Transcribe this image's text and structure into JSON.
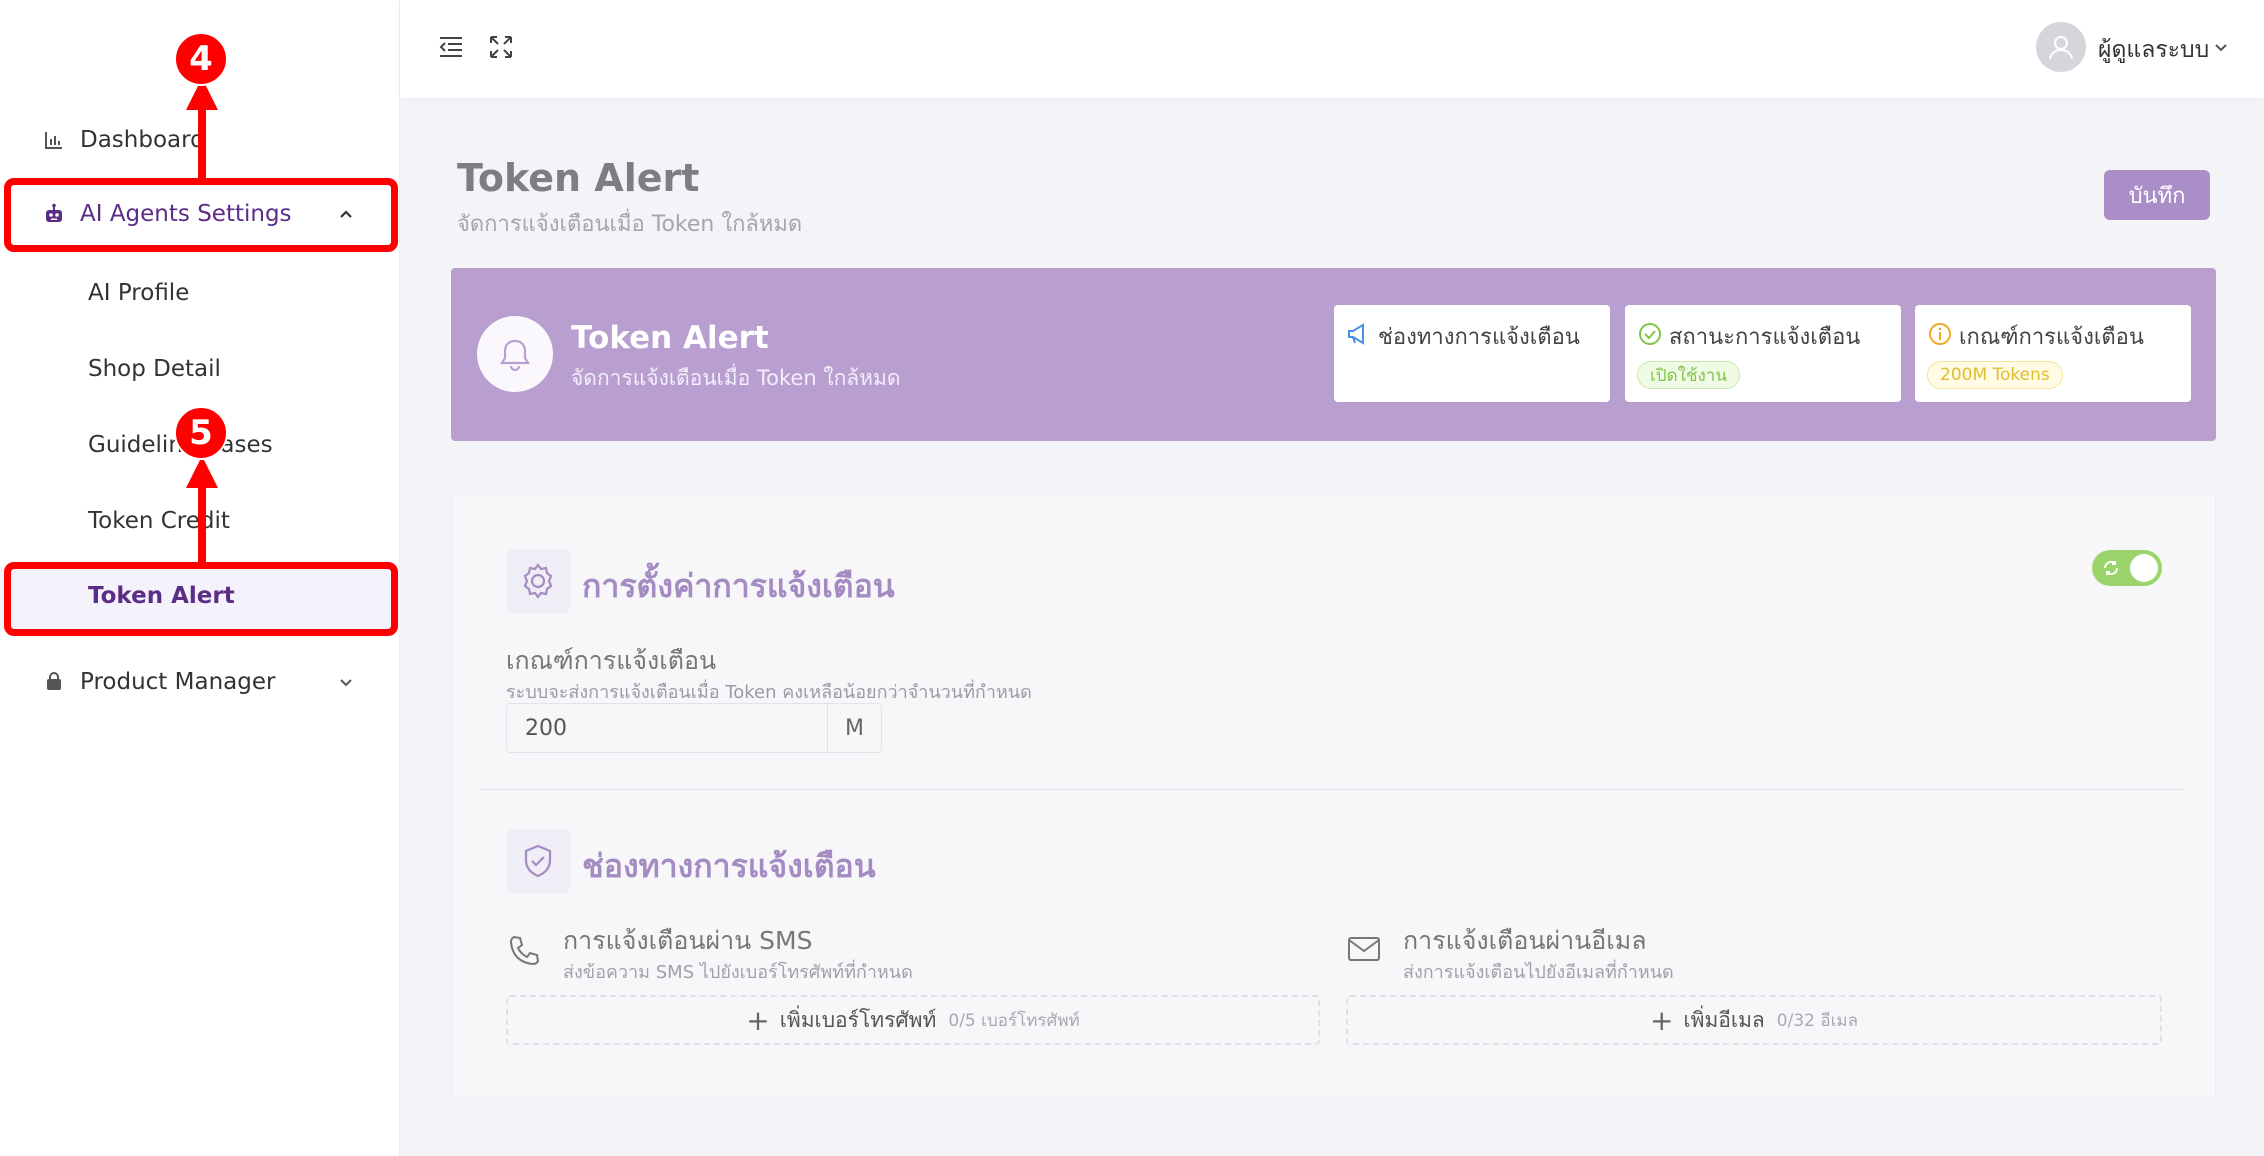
{
  "sidebar": {
    "items": [
      {
        "label": "Dashboard"
      },
      {
        "label": "AI Agents Settings"
      },
      {
        "label": "Product Manager"
      }
    ],
    "subitems": [
      {
        "label": "AI Profile"
      },
      {
        "label": "Shop Detail"
      },
      {
        "label": "Guideline Cases"
      },
      {
        "label": "Token Credit"
      },
      {
        "label": "Token Alert"
      }
    ]
  },
  "annotations": {
    "step4": "4",
    "step5": "5"
  },
  "topbar": {
    "user_name": "ผู้ดูแลระบบ"
  },
  "page": {
    "title": "Token Alert",
    "subtitle": "จัดการแจ้งเตือนเมื่อ Token ใกล้หมด",
    "save_label": "บันทึก"
  },
  "banner": {
    "title": "Token Alert",
    "subtitle": "จัดการแจ้งเตือนเมื่อ Token ใกล้หมด",
    "stats": [
      {
        "label": "ช่องทางการแจ้งเตือน",
        "value": ""
      },
      {
        "label": "สถานะการแจ้งเตือน",
        "value": "เปิดใช้งาน"
      },
      {
        "label": "เกณฑ์การแจ้งเตือน",
        "value": "200M Tokens"
      }
    ]
  },
  "settings": {
    "title": "การตั้งค่าการแจ้งเตือน",
    "threshold_label": "เกณฑ์การแจ้งเตือน",
    "threshold_help": "ระบบจะส่งการแจ้งเตือนเมื่อ Token คงเหลือน้อยกว่าจำนวนที่กำหนด",
    "threshold_value": "200",
    "threshold_unit": "M",
    "enabled": true
  },
  "channels": {
    "title": "ช่องทางการแจ้งเตือน",
    "sms": {
      "title": "การแจ้งเตือนผ่าน SMS",
      "subtitle": "ส่งข้อความ SMS ไปยังเบอร์โทรศัพท์ที่กำหนด",
      "add_label": "เพิ่มเบอร์โทรศัพท์",
      "count": "0/5 เบอร์โทรศัพท์"
    },
    "email": {
      "title": "การแจ้งเตือนผ่านอีเมล",
      "subtitle": "ส่งการแจ้งเตือนไปยังอีเมลที่กำหนด",
      "add_label": "เพิ่มอีเมล",
      "count": "0/32 อีเมล"
    }
  },
  "colors": {
    "brand_purple": "#b89fd0",
    "active_text": "#5b2d86",
    "annotation_red": "#ff0000",
    "toggle_on": "#9bd46a"
  }
}
